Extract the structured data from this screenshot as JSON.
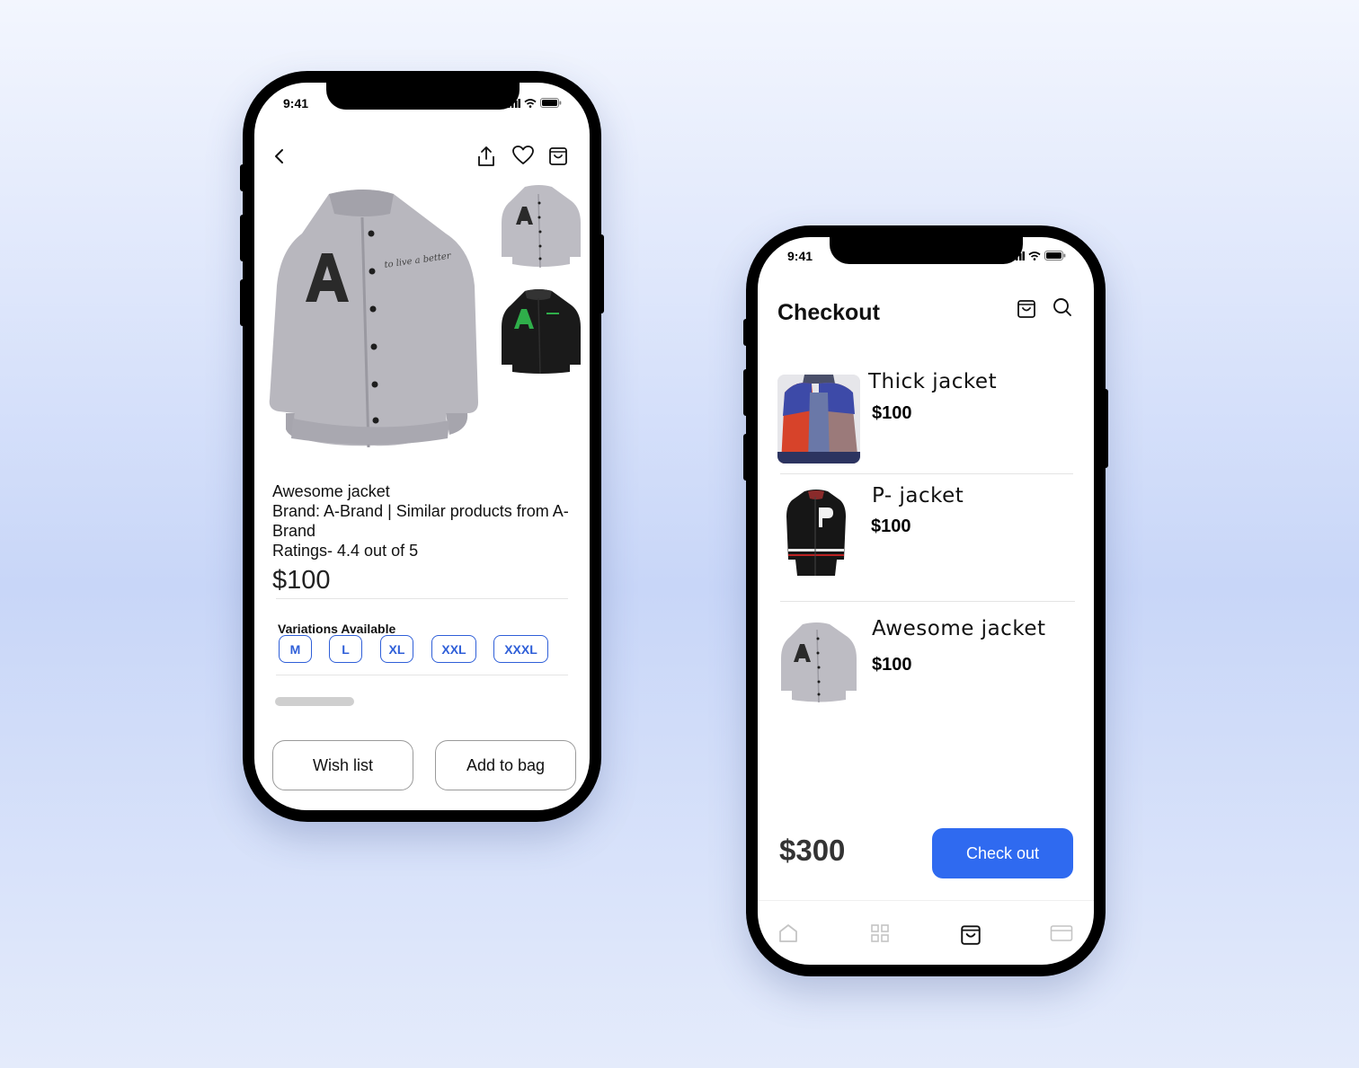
{
  "product_screen": {
    "status_time": "9:41",
    "icons": {
      "back": "chevron-left-icon",
      "share": "share-icon",
      "wishlist": "heart-icon",
      "bag": "bag-icon"
    },
    "product_name": "Awesome jacket",
    "brand_line": "Brand: A-Brand | Similar products from A-Brand",
    "ratings": "Ratings- 4.4 out of 5",
    "price": "$100",
    "variations_title": "Variations Available",
    "sizes": [
      "M",
      "L",
      "XL",
      "XXL",
      "XXXL"
    ],
    "wishlist_label": "Wish list",
    "add_to_bag_label": "Add to bag",
    "jacket_script_text": "to live a better"
  },
  "checkout_screen": {
    "status_time": "9:41",
    "title": "Checkout",
    "items": [
      {
        "name": "Thick jacket",
        "price": "$100"
      },
      {
        "name": "P- jacket",
        "price": "$100"
      },
      {
        "name": "Awesome jacket",
        "price": "$100"
      }
    ],
    "total": "$300",
    "checkout_label": "Check out",
    "tabs": [
      "home-icon",
      "grid-icon",
      "bag-icon",
      "card-icon"
    ],
    "active_tab": "bag-icon"
  },
  "colors": {
    "accent": "#2f6af0",
    "chip": "#2f5fd8"
  }
}
